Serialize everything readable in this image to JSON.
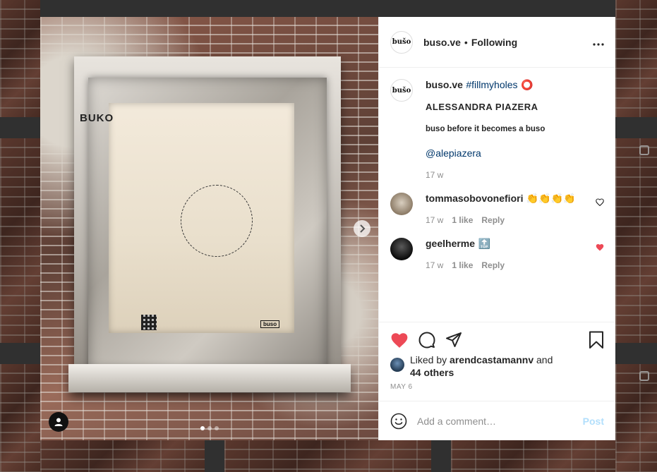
{
  "post": {
    "username": "buso.ve",
    "avatar_text": "bušo",
    "follow_separator": "•",
    "follow_status": "Following",
    "more_icon": "more-horizontal-icon"
  },
  "photo": {
    "poster_title": "BUKO",
    "poster_logo": "buso",
    "slide_count": 3,
    "active_slide": 1
  },
  "caption": {
    "username": "buso.ve",
    "hashtag": "#fillmyholes",
    "emoji": "⭕",
    "line1": "ALESSANDRA PIAZERA",
    "line2": "buso before it becomes a buso",
    "mention": "@alepiazera",
    "time": "17 w"
  },
  "comments": [
    {
      "username": "tommasobovonefiori",
      "text": "👏👏👏👏",
      "time": "17 w",
      "likes": "1 like",
      "reply": "Reply",
      "liked": false
    },
    {
      "username": "geelherme",
      "text": "🔝",
      "time": "17 w",
      "likes": "1 like",
      "reply": "Reply",
      "liked": true
    }
  ],
  "actions": {
    "liked_by_prefix": "Liked by",
    "liked_by_user": "arendcastamannv",
    "liked_by_and": "and",
    "others": "44 others",
    "date": "MAY 6"
  },
  "comment_box": {
    "placeholder": "Add a comment…",
    "post_label": "Post"
  },
  "colors": {
    "heart_red": "#ed4956",
    "link_blue": "#00376b",
    "post_disabled": "#b2dffc",
    "muted": "#8e8e8e"
  }
}
